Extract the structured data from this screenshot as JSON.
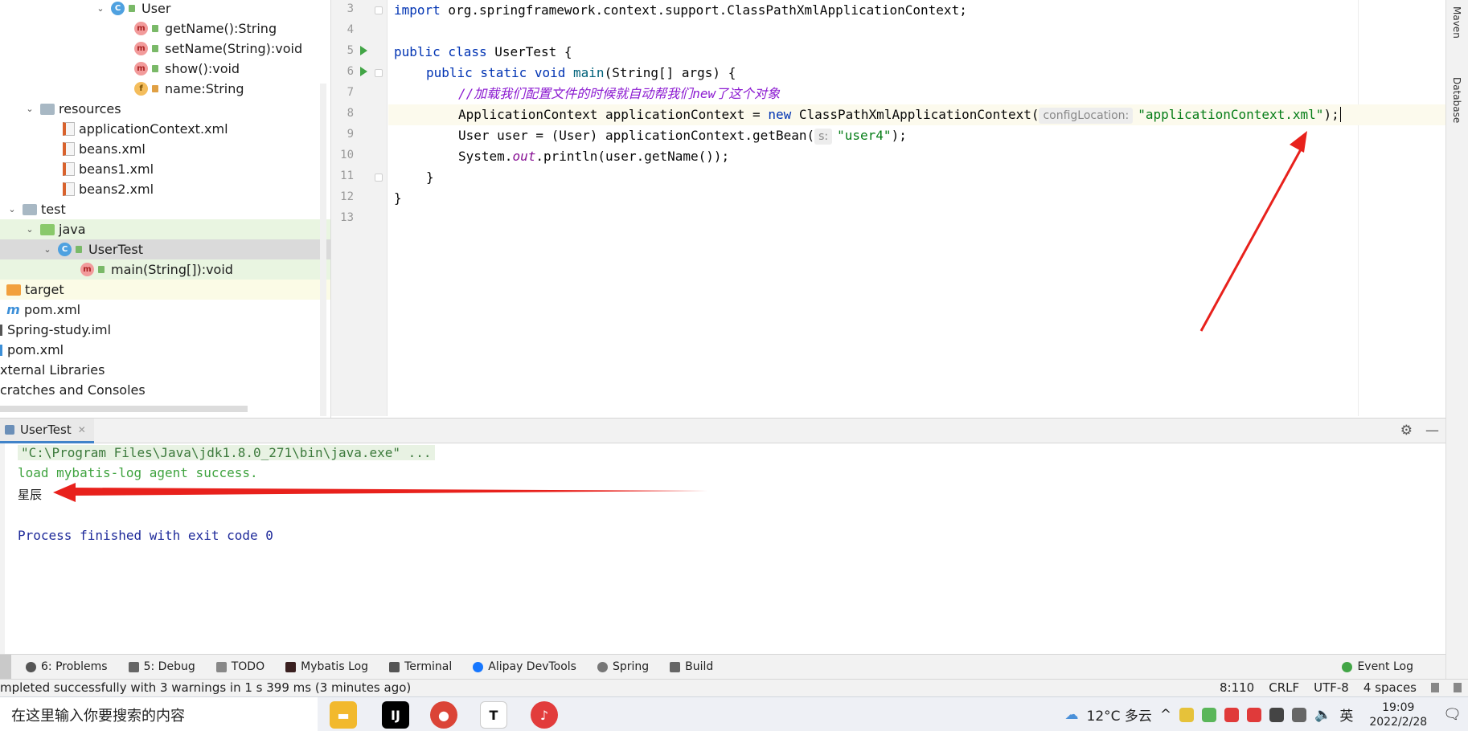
{
  "tree": {
    "items": [
      {
        "label": "User",
        "icon": "class-icon"
      },
      {
        "label": "getName():String",
        "icon": "method-icon"
      },
      {
        "label": "setName(String):void",
        "icon": "method-icon"
      },
      {
        "label": "show():void",
        "icon": "method-icon"
      },
      {
        "label": "name:String",
        "icon": "field-icon"
      },
      {
        "label": "resources",
        "icon": "folder-icon"
      },
      {
        "label": "applicationContext.xml",
        "icon": "xml-file-icon"
      },
      {
        "label": "beans.xml",
        "icon": "xml-file-icon"
      },
      {
        "label": "beans1.xml",
        "icon": "xml-file-icon"
      },
      {
        "label": "beans2.xml",
        "icon": "xml-file-icon"
      },
      {
        "label": "test",
        "icon": "folder-icon"
      },
      {
        "label": "java",
        "icon": "source-folder-icon"
      },
      {
        "label": "UserTest",
        "icon": "class-icon"
      },
      {
        "label": "main(String[]):void",
        "icon": "method-icon"
      },
      {
        "label": "target",
        "icon": "excluded-folder-icon"
      },
      {
        "label": "pom.xml",
        "icon": "maven-file-icon"
      },
      {
        "label": "Spring-study.iml",
        "icon": "module-file-icon"
      },
      {
        "label": "pom.xml",
        "icon": "maven-file-icon"
      },
      {
        "label": "xternal Libraries",
        "icon": "library-icon"
      },
      {
        "label": "cratches and Consoles",
        "icon": "scratches-icon"
      }
    ]
  },
  "editor": {
    "line_numbers": [
      "3",
      "4",
      "5",
      "6",
      "7",
      "8",
      "9",
      "10",
      "11",
      "12",
      "13"
    ],
    "line3": {
      "kw": "import",
      "rest": " org.springframework.context.support.ClassPathXmlApplicationContext;"
    },
    "line5": {
      "kw": "public class",
      "rest": " UserTest {"
    },
    "line6": {
      "kw": "public static void",
      "mn": "main",
      "rest": "(String[] args) {"
    },
    "line7": {
      "comment": "//加载我们配置文件的时候就自动帮我们new了这个对象"
    },
    "line8": {
      "pre": "ApplicationContext applicationContext = ",
      "kw": "new",
      "mid": " ClassPathXmlApplicationContext(",
      "hint": "configLocation:",
      "str": "\"applicationContext.xml\"",
      "post": ");"
    },
    "line9": {
      "pre": "User user = (User) applicationContext.getBean(",
      "hint": "s:",
      "str": "\"user4\"",
      "post": ");"
    },
    "line10": {
      "pre": "System.",
      "out": "out",
      "post": ".println(user.getName());"
    },
    "line11": "}",
    "line12": "}"
  },
  "right_strip": {
    "maven": "Maven",
    "database": "Database"
  },
  "run_panel": {
    "tab": "UserTest",
    "lines": [
      "\"C:\\Program Files\\Java\\jdk1.8.0_271\\bin\\java.exe\" ...",
      "load mybatis-log agent success.",
      "星辰",
      "Process finished with exit code 0"
    ]
  },
  "tool_windows": [
    {
      "label": "6: Problems",
      "icon": "problems-icon"
    },
    {
      "label": "5: Debug",
      "icon": "debug-icon"
    },
    {
      "label": "TODO",
      "icon": "todo-icon"
    },
    {
      "label": "Mybatis Log",
      "icon": "mybatis-icon"
    },
    {
      "label": "Terminal",
      "icon": "terminal-icon"
    },
    {
      "label": "Alipay DevTools",
      "icon": "alipay-icon"
    },
    {
      "label": "Spring",
      "icon": "spring-icon"
    },
    {
      "label": "Build",
      "icon": "build-icon"
    }
  ],
  "event_log": "Event Log",
  "status": {
    "message": "mpleted successfully with 3 warnings in 1 s 399 ms (3 minutes ago)",
    "position": "8:110",
    "line_sep": "CRLF",
    "encoding": "UTF-8",
    "indent": "4 spaces"
  },
  "taskbar": {
    "search_placeholder": "在这里输入你要搜索的内容",
    "weather": "12°C 多云",
    "ime": "英",
    "time": "19:09",
    "date": "2022/2/28"
  },
  "colors": {
    "annotation_arrow": "#e8211c",
    "caret_line": "#fcfaed",
    "run_icon": "#42a546"
  }
}
